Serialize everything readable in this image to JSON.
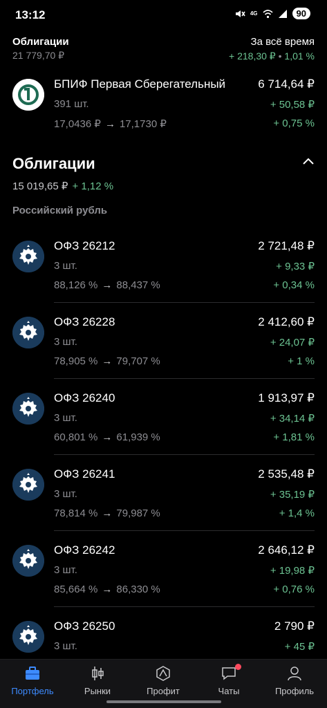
{
  "status": {
    "time": "13:12",
    "network": "4G",
    "battery": "90"
  },
  "header": {
    "title": "Облигации",
    "value": "21 779,70 ₽",
    "period": "За всё время",
    "change_abs": "+ 218,30 ₽",
    "change_sep": "•",
    "change_pct": "1,01 %"
  },
  "fund": {
    "name": "БПИФ Первая Сберегательный",
    "qty": "391 шт.",
    "price_from": "17,0436 ₽",
    "price_to": "17,1730 ₽",
    "amount": "6 714,64 ₽",
    "gain_abs": "+ 50,58 ₽",
    "gain_pct": "+ 0,75 %"
  },
  "section": {
    "title": "Облигации",
    "value": "15 019,65 ₽",
    "pct": "+ 1,12 %",
    "currency": "Российский рубль"
  },
  "bonds": [
    {
      "name": "ОФЗ 26212",
      "qty": "3 шт.",
      "price_from": "88,126 %",
      "price_to": "88,437 %",
      "amount": "2 721,48 ₽",
      "gain_abs": "+ 9,33 ₽",
      "gain_pct": "+ 0,34 %"
    },
    {
      "name": "ОФЗ 26228",
      "qty": "3 шт.",
      "price_from": "78,905 %",
      "price_to": "79,707 %",
      "amount": "2 412,60 ₽",
      "gain_abs": "+ 24,07 ₽",
      "gain_pct": "+ 1 %"
    },
    {
      "name": "ОФЗ 26240",
      "qty": "3 шт.",
      "price_from": "60,801 %",
      "price_to": "61,939 %",
      "amount": "1 913,97 ₽",
      "gain_abs": "+ 34,14 ₽",
      "gain_pct": "+ 1,81 %"
    },
    {
      "name": "ОФЗ 26241",
      "qty": "3 шт.",
      "price_from": "78,814 %",
      "price_to": "79,987 %",
      "amount": "2 535,48 ₽",
      "gain_abs": "+ 35,19 ₽",
      "gain_pct": "+ 1,4 %"
    },
    {
      "name": "ОФЗ 26242",
      "qty": "3 шт.",
      "price_from": "85,664 %",
      "price_to": "86,330 %",
      "amount": "2 646,12 ₽",
      "gain_abs": "+ 19,98 ₽",
      "gain_pct": "+ 0,76 %"
    },
    {
      "name": "ОФЗ 26250",
      "qty": "3 шт.",
      "price_from": "",
      "price_to": "",
      "amount": "2 790 ₽",
      "gain_abs": "+ 45 ₽",
      "gain_pct": ""
    }
  ],
  "arrow": "→",
  "tabs": [
    {
      "label": "Портфель",
      "icon": "briefcase-icon",
      "active": true
    },
    {
      "label": "Рынки",
      "icon": "candlestick-icon",
      "active": false
    },
    {
      "label": "Профит",
      "icon": "profit-icon",
      "active": false
    },
    {
      "label": "Чаты",
      "icon": "chat-icon",
      "active": false
    },
    {
      "label": "Профиль",
      "icon": "person-icon",
      "active": false
    }
  ],
  "colors": {
    "positive": "#6cc392",
    "accent": "#3d8bff",
    "muted": "#8d8d92"
  }
}
